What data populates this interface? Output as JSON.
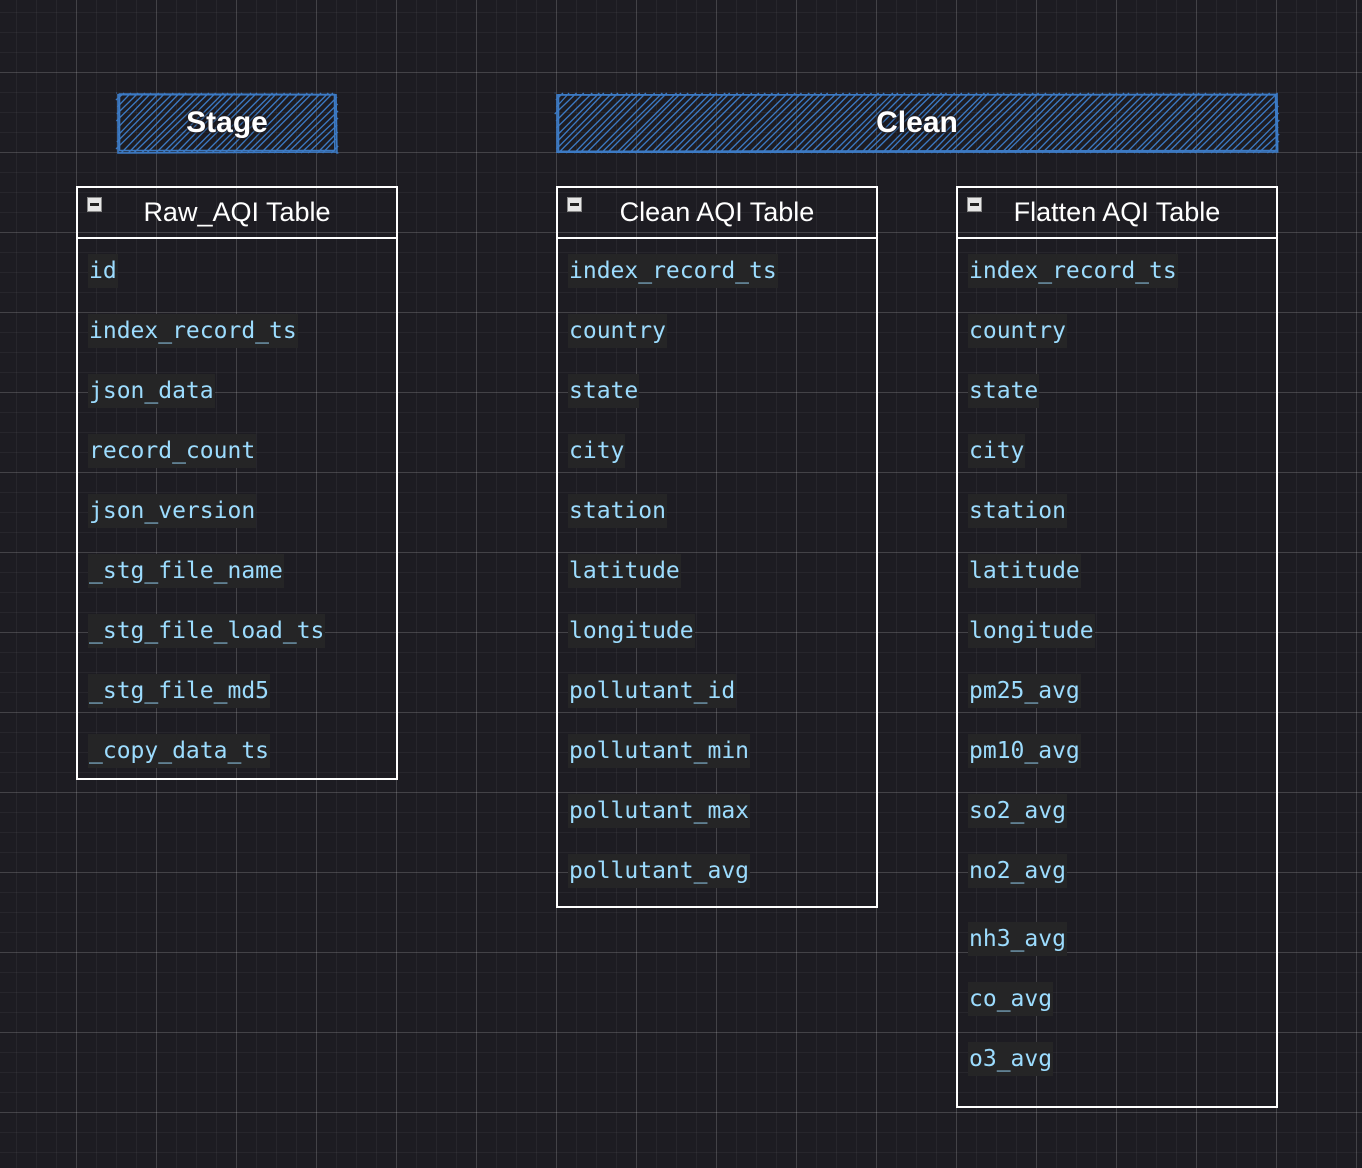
{
  "groups": {
    "stage": {
      "label": "Stage"
    },
    "clean": {
      "label": "Clean"
    }
  },
  "tables": [
    {
      "title": "Raw_AQI Table",
      "fields": [
        "id",
        "index_record_ts",
        "json_data",
        "record_count",
        "json_version",
        "_stg_file_name",
        "_stg_file_load_ts",
        "_stg_file_md5",
        "_copy_data_ts"
      ]
    },
    {
      "title": "Clean AQI Table",
      "fields": [
        "index_record_ts",
        "country",
        "state",
        "city",
        "station",
        "latitude",
        "longitude",
        "pollutant_id",
        "pollutant_min",
        "pollutant_max",
        "pollutant_avg"
      ]
    },
    {
      "title": "Flatten AQI Table",
      "fields": [
        "index_record_ts",
        "country",
        "state",
        "city",
        "station",
        "latitude",
        "longitude",
        "pm25_avg",
        "pm10_avg",
        "so2_avg",
        "no2_avg",
        "nh3_avg",
        "co_avg",
        "o3_avg"
      ]
    }
  ],
  "colors": {
    "background": "#1d1c22",
    "group_stroke": "#3c7ac4",
    "table_border": "#ffffff",
    "field_text": "#9cdcfe",
    "field_background": "#252526"
  },
  "icons": {
    "collapse": "collapse-minus-icon"
  }
}
